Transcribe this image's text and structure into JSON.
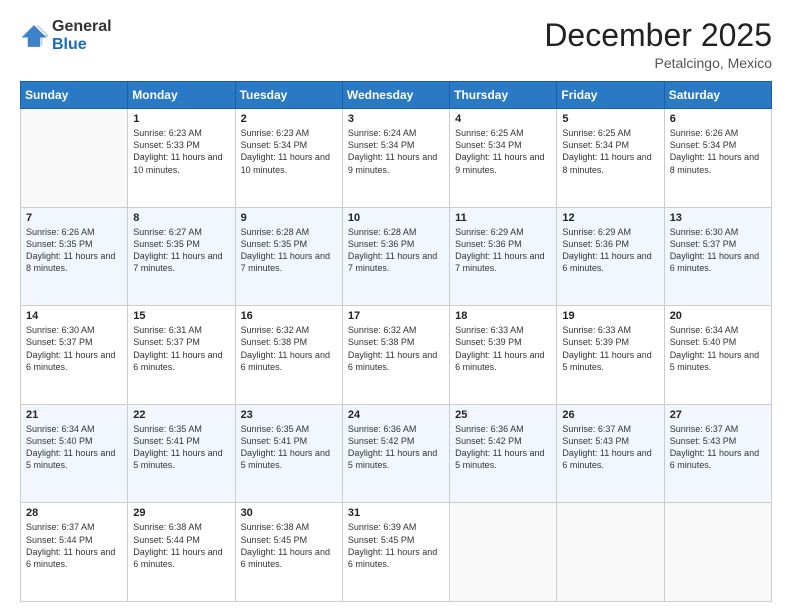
{
  "logo": {
    "general": "General",
    "blue": "Blue"
  },
  "header": {
    "month": "December 2025",
    "location": "Petalcingo, Mexico"
  },
  "weekdays": [
    "Sunday",
    "Monday",
    "Tuesday",
    "Wednesday",
    "Thursday",
    "Friday",
    "Saturday"
  ],
  "weeks": [
    [
      {
        "day": "",
        "sunrise": "",
        "sunset": "",
        "daylight": ""
      },
      {
        "day": "1",
        "sunrise": "Sunrise: 6:23 AM",
        "sunset": "Sunset: 5:33 PM",
        "daylight": "Daylight: 11 hours and 10 minutes."
      },
      {
        "day": "2",
        "sunrise": "Sunrise: 6:23 AM",
        "sunset": "Sunset: 5:34 PM",
        "daylight": "Daylight: 11 hours and 10 minutes."
      },
      {
        "day": "3",
        "sunrise": "Sunrise: 6:24 AM",
        "sunset": "Sunset: 5:34 PM",
        "daylight": "Daylight: 11 hours and 9 minutes."
      },
      {
        "day": "4",
        "sunrise": "Sunrise: 6:25 AM",
        "sunset": "Sunset: 5:34 PM",
        "daylight": "Daylight: 11 hours and 9 minutes."
      },
      {
        "day": "5",
        "sunrise": "Sunrise: 6:25 AM",
        "sunset": "Sunset: 5:34 PM",
        "daylight": "Daylight: 11 hours and 8 minutes."
      },
      {
        "day": "6",
        "sunrise": "Sunrise: 6:26 AM",
        "sunset": "Sunset: 5:34 PM",
        "daylight": "Daylight: 11 hours and 8 minutes."
      }
    ],
    [
      {
        "day": "7",
        "sunrise": "Sunrise: 6:26 AM",
        "sunset": "Sunset: 5:35 PM",
        "daylight": "Daylight: 11 hours and 8 minutes."
      },
      {
        "day": "8",
        "sunrise": "Sunrise: 6:27 AM",
        "sunset": "Sunset: 5:35 PM",
        "daylight": "Daylight: 11 hours and 7 minutes."
      },
      {
        "day": "9",
        "sunrise": "Sunrise: 6:28 AM",
        "sunset": "Sunset: 5:35 PM",
        "daylight": "Daylight: 11 hours and 7 minutes."
      },
      {
        "day": "10",
        "sunrise": "Sunrise: 6:28 AM",
        "sunset": "Sunset: 5:36 PM",
        "daylight": "Daylight: 11 hours and 7 minutes."
      },
      {
        "day": "11",
        "sunrise": "Sunrise: 6:29 AM",
        "sunset": "Sunset: 5:36 PM",
        "daylight": "Daylight: 11 hours and 7 minutes."
      },
      {
        "day": "12",
        "sunrise": "Sunrise: 6:29 AM",
        "sunset": "Sunset: 5:36 PM",
        "daylight": "Daylight: 11 hours and 6 minutes."
      },
      {
        "day": "13",
        "sunrise": "Sunrise: 6:30 AM",
        "sunset": "Sunset: 5:37 PM",
        "daylight": "Daylight: 11 hours and 6 minutes."
      }
    ],
    [
      {
        "day": "14",
        "sunrise": "Sunrise: 6:30 AM",
        "sunset": "Sunset: 5:37 PM",
        "daylight": "Daylight: 11 hours and 6 minutes."
      },
      {
        "day": "15",
        "sunrise": "Sunrise: 6:31 AM",
        "sunset": "Sunset: 5:37 PM",
        "daylight": "Daylight: 11 hours and 6 minutes."
      },
      {
        "day": "16",
        "sunrise": "Sunrise: 6:32 AM",
        "sunset": "Sunset: 5:38 PM",
        "daylight": "Daylight: 11 hours and 6 minutes."
      },
      {
        "day": "17",
        "sunrise": "Sunrise: 6:32 AM",
        "sunset": "Sunset: 5:38 PM",
        "daylight": "Daylight: 11 hours and 6 minutes."
      },
      {
        "day": "18",
        "sunrise": "Sunrise: 6:33 AM",
        "sunset": "Sunset: 5:39 PM",
        "daylight": "Daylight: 11 hours and 6 minutes."
      },
      {
        "day": "19",
        "sunrise": "Sunrise: 6:33 AM",
        "sunset": "Sunset: 5:39 PM",
        "daylight": "Daylight: 11 hours and 5 minutes."
      },
      {
        "day": "20",
        "sunrise": "Sunrise: 6:34 AM",
        "sunset": "Sunset: 5:40 PM",
        "daylight": "Daylight: 11 hours and 5 minutes."
      }
    ],
    [
      {
        "day": "21",
        "sunrise": "Sunrise: 6:34 AM",
        "sunset": "Sunset: 5:40 PM",
        "daylight": "Daylight: 11 hours and 5 minutes."
      },
      {
        "day": "22",
        "sunrise": "Sunrise: 6:35 AM",
        "sunset": "Sunset: 5:41 PM",
        "daylight": "Daylight: 11 hours and 5 minutes."
      },
      {
        "day": "23",
        "sunrise": "Sunrise: 6:35 AM",
        "sunset": "Sunset: 5:41 PM",
        "daylight": "Daylight: 11 hours and 5 minutes."
      },
      {
        "day": "24",
        "sunrise": "Sunrise: 6:36 AM",
        "sunset": "Sunset: 5:42 PM",
        "daylight": "Daylight: 11 hours and 5 minutes."
      },
      {
        "day": "25",
        "sunrise": "Sunrise: 6:36 AM",
        "sunset": "Sunset: 5:42 PM",
        "daylight": "Daylight: 11 hours and 5 minutes."
      },
      {
        "day": "26",
        "sunrise": "Sunrise: 6:37 AM",
        "sunset": "Sunset: 5:43 PM",
        "daylight": "Daylight: 11 hours and 6 minutes."
      },
      {
        "day": "27",
        "sunrise": "Sunrise: 6:37 AM",
        "sunset": "Sunset: 5:43 PM",
        "daylight": "Daylight: 11 hours and 6 minutes."
      }
    ],
    [
      {
        "day": "28",
        "sunrise": "Sunrise: 6:37 AM",
        "sunset": "Sunset: 5:44 PM",
        "daylight": "Daylight: 11 hours and 6 minutes."
      },
      {
        "day": "29",
        "sunrise": "Sunrise: 6:38 AM",
        "sunset": "Sunset: 5:44 PM",
        "daylight": "Daylight: 11 hours and 6 minutes."
      },
      {
        "day": "30",
        "sunrise": "Sunrise: 6:38 AM",
        "sunset": "Sunset: 5:45 PM",
        "daylight": "Daylight: 11 hours and 6 minutes."
      },
      {
        "day": "31",
        "sunrise": "Sunrise: 6:39 AM",
        "sunset": "Sunset: 5:45 PM",
        "daylight": "Daylight: 11 hours and 6 minutes."
      },
      {
        "day": "",
        "sunrise": "",
        "sunset": "",
        "daylight": ""
      },
      {
        "day": "",
        "sunrise": "",
        "sunset": "",
        "daylight": ""
      },
      {
        "day": "",
        "sunrise": "",
        "sunset": "",
        "daylight": ""
      }
    ]
  ]
}
